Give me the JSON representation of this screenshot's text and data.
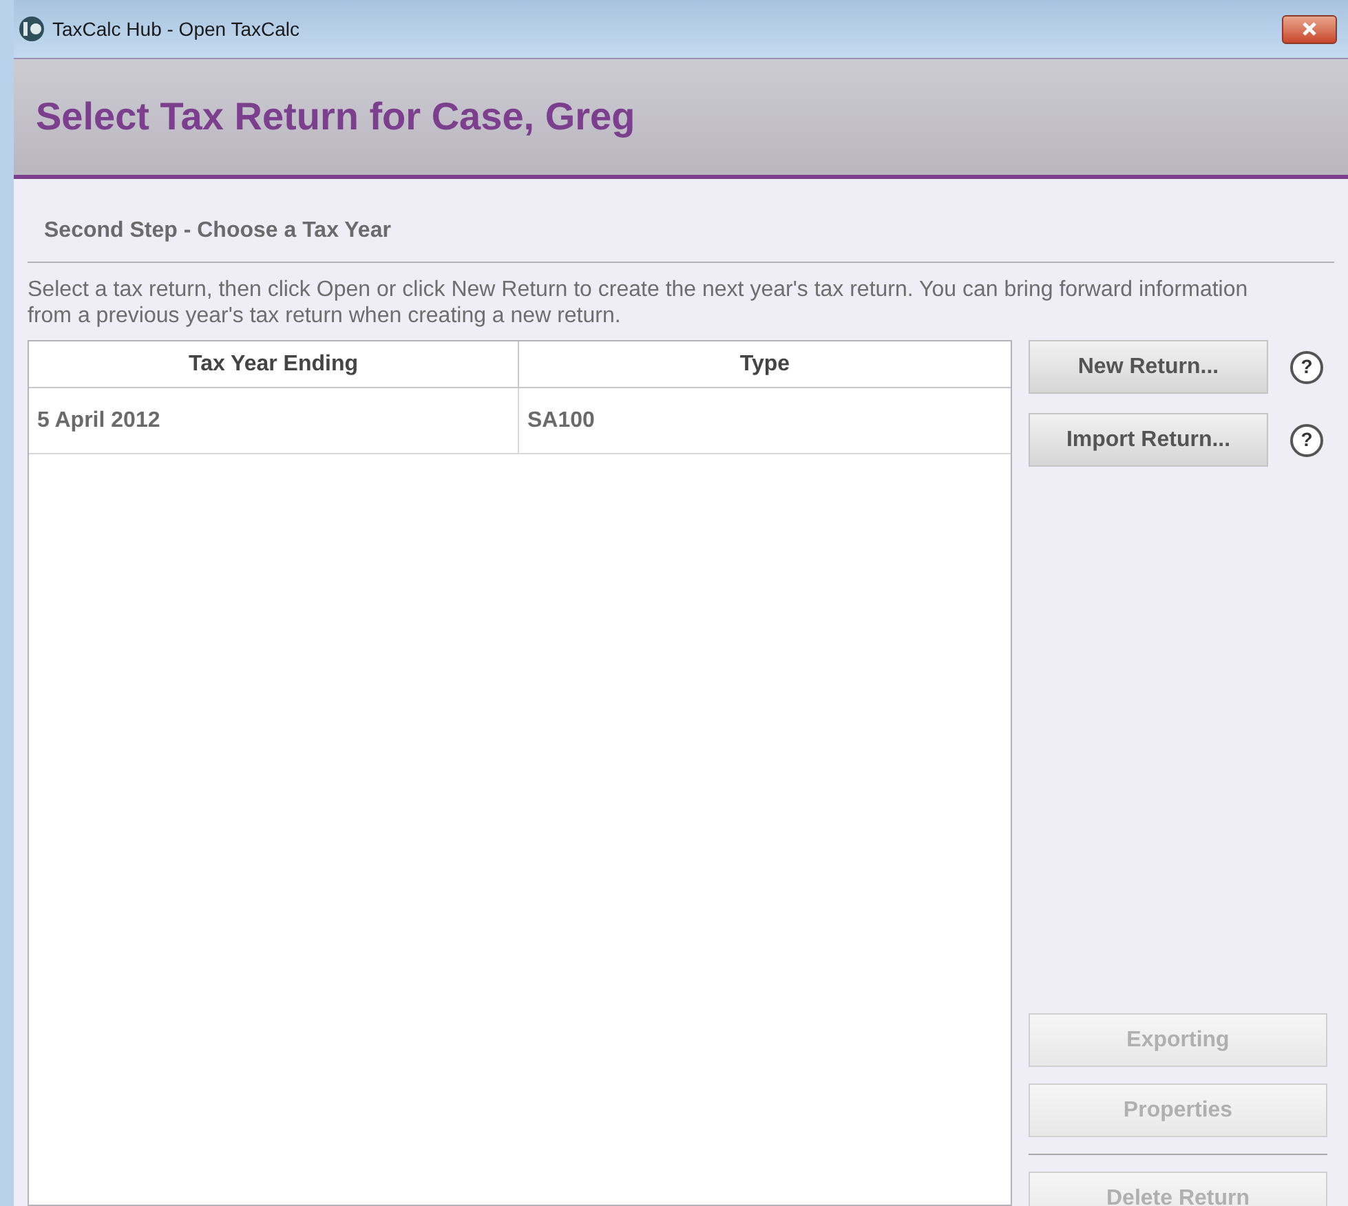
{
  "window": {
    "title": "TaxCalc Hub - Open TaxCalc"
  },
  "header": {
    "title": "Select Tax Return for Case, Greg"
  },
  "step": {
    "title": "Second Step - Choose a Tax Year"
  },
  "instructions": "Select a tax return, then click Open or click New Return to create the next year's tax return. You can bring forward information from a previous year's tax return when creating a new return.",
  "table": {
    "columns": [
      "Tax Year Ending",
      "Type"
    ],
    "rows": [
      [
        "5 April 2012",
        "SA100"
      ]
    ]
  },
  "top_buttons": [
    {
      "label": "New Return...",
      "disabled": false,
      "help": "?"
    },
    {
      "label": "Import Return...",
      "disabled": false,
      "help": "?"
    }
  ],
  "bottom_buttons": [
    {
      "label": "Exporting",
      "disabled": true
    },
    {
      "label": "Properties",
      "disabled": true
    },
    {
      "label": "Delete Return",
      "disabled": true
    }
  ]
}
